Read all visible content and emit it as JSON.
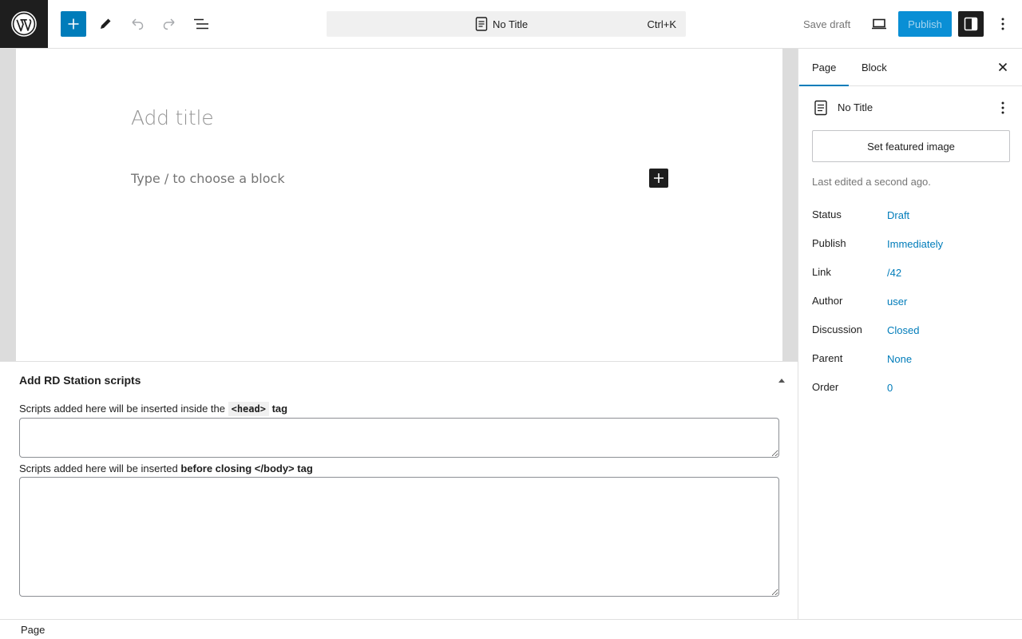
{
  "topbar": {
    "document_title": "No Title",
    "shortcut": "Ctrl+K",
    "save_draft_label": "Save draft",
    "publish_label": "Publish",
    "icons": [
      "wordpress-icon",
      "plus-icon",
      "pencil-icon",
      "undo-icon",
      "redo-icon",
      "list-view-icon",
      "page-icon",
      "desktop-icon",
      "sidebar-icon",
      "more-vertical-icon"
    ]
  },
  "canvas": {
    "title_placeholder": "Add title",
    "block_placeholder": "Type / to choose a block"
  },
  "metabox": {
    "title": "Add RD Station scripts",
    "head_label_prefix": "Scripts added here will be inserted inside the ",
    "head_label_code": "<head>",
    "head_label_suffix": " tag",
    "body_label_prefix": "Scripts added here will be inserted ",
    "body_label_bold": "before closing </body> tag",
    "head_value": "",
    "body_value": ""
  },
  "sidebar": {
    "tabs": [
      {
        "label": "Page",
        "active": true
      },
      {
        "label": "Block",
        "active": false
      }
    ],
    "document_title": "No Title",
    "featured_image_label": "Set featured image",
    "last_edited": "Last edited a second ago.",
    "rows": [
      {
        "key": "Status",
        "value": "Draft"
      },
      {
        "key": "Publish",
        "value": "Immediately"
      },
      {
        "key": "Link",
        "value": "/42"
      },
      {
        "key": "Author",
        "value": "user"
      },
      {
        "key": "Discussion",
        "value": "Closed"
      },
      {
        "key": "Parent",
        "value": "None"
      },
      {
        "key": "Order",
        "value": "0"
      }
    ]
  },
  "footer": {
    "breadcrumb": "Page"
  },
  "colors": {
    "accent": "#007cba",
    "dark": "#1e1e1e",
    "publish_bg": "#0a8fd5"
  }
}
